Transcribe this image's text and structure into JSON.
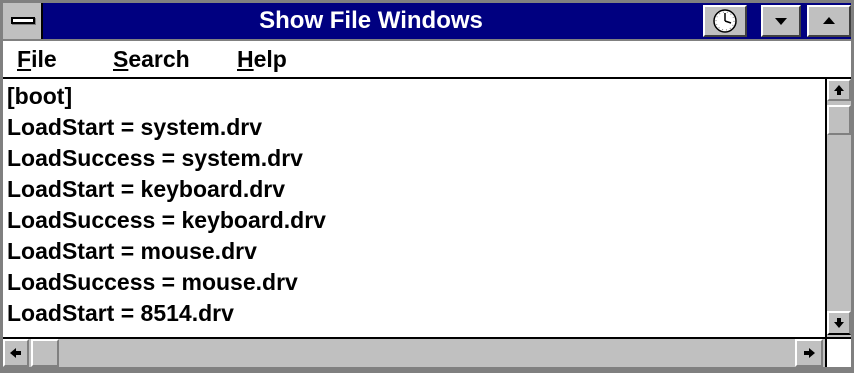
{
  "window": {
    "title": "Show File Windows"
  },
  "menu": {
    "file": {
      "accel": "F",
      "rest": "ile"
    },
    "search": {
      "accel": "S",
      "rest": "earch"
    },
    "help": {
      "accel": "H",
      "rest": "elp"
    }
  },
  "content": {
    "lines": [
      "[boot]",
      "LoadStart = system.drv",
      "LoadSuccess = system.drv",
      "LoadStart = keyboard.drv",
      "LoadSuccess = keyboard.drv",
      "LoadStart = mouse.drv",
      "LoadSuccess = mouse.drv",
      "LoadStart = 8514.drv"
    ]
  },
  "icons": {
    "system_menu": "system-menu-icon",
    "clock": "clock-icon",
    "minimize": "minimize-arrow-icon",
    "maximize": "maximize-arrow-icon",
    "scroll_up": "scroll-up-arrow-icon",
    "scroll_down": "scroll-down-arrow-icon",
    "scroll_left": "scroll-left-arrow-icon",
    "scroll_right": "scroll-right-arrow-icon"
  },
  "colors": {
    "title_bar": "#000080",
    "title_text": "#ffffff",
    "chrome": "#c0c0c0",
    "frame": "#808080",
    "content_bg": "#ffffff",
    "text": "#000000"
  }
}
